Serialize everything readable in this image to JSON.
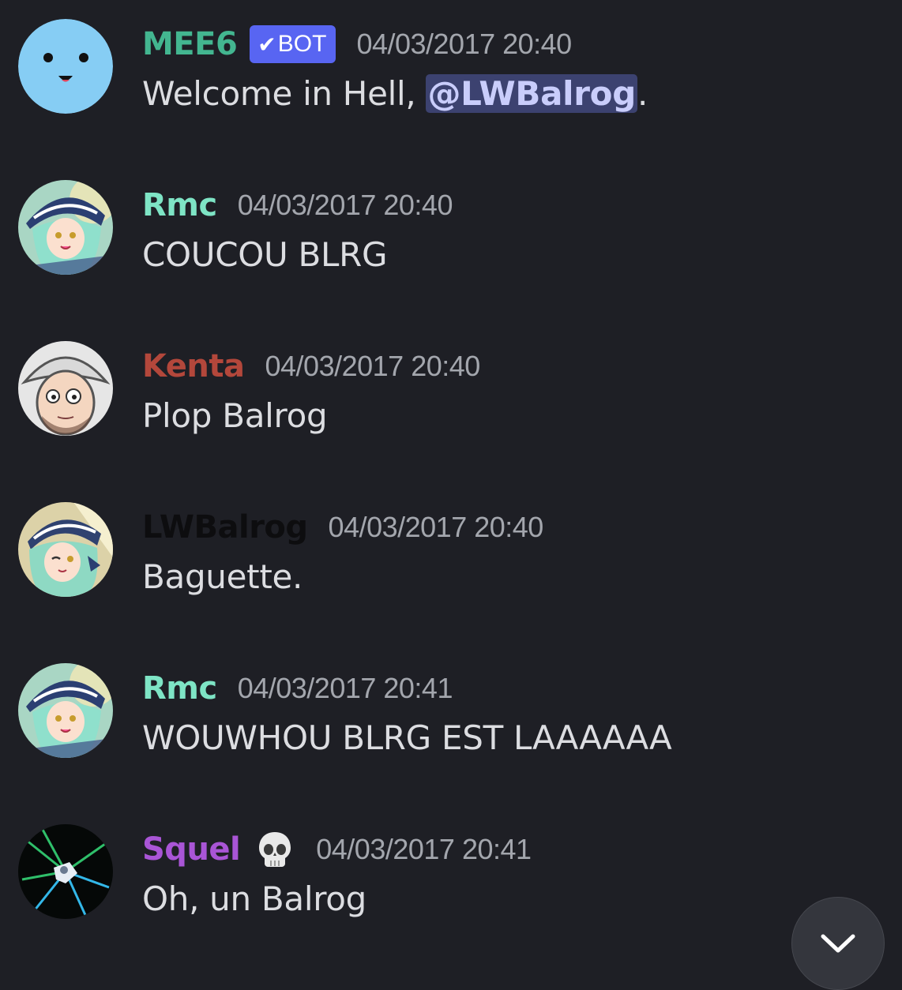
{
  "colors": {
    "background": "#1e1f25",
    "mention_bg": "#3c4270",
    "bot_tag": "#5865f2"
  },
  "messages": [
    {
      "author": "MEE6",
      "author_color": "#43b690",
      "bot_tag": "BOT",
      "timestamp": "04/03/2017 20:40",
      "text_before": "Welcome in Hell, ",
      "mention": "@LWBalrog",
      "text_after": ".",
      "avatar": "mee6-smiley-icon"
    },
    {
      "author": "Rmc",
      "author_color": "#7ee4c5",
      "timestamp": "04/03/2017 20:40",
      "text": "COUCOU BLRG",
      "avatar": "anime-girl-avatar"
    },
    {
      "author": "Kenta",
      "author_color": "#b3473b",
      "timestamp": "04/03/2017 20:40",
      "text": "Plop Balrog",
      "avatar": "cartoon-man-avatar"
    },
    {
      "author": "LWBalrog",
      "author_color": "#0d0d0f",
      "timestamp": "04/03/2017 20:40",
      "text": "Baguette.",
      "avatar": "anime-girl-avatar"
    },
    {
      "author": "Rmc",
      "author_color": "#7ee4c5",
      "timestamp": "04/03/2017 20:41",
      "text": "WOUWHOU BLRG EST LAAAAAA",
      "avatar": "anime-girl-avatar"
    },
    {
      "author": "Squel",
      "author_color": "#a955d6",
      "status_emoji": "skull-icon",
      "timestamp": "04/03/2017 20:41",
      "text": "Oh, un Balrog",
      "avatar": "dark-burst-avatar"
    }
  ],
  "scroll_button": {
    "icon": "chevron-down-icon"
  }
}
